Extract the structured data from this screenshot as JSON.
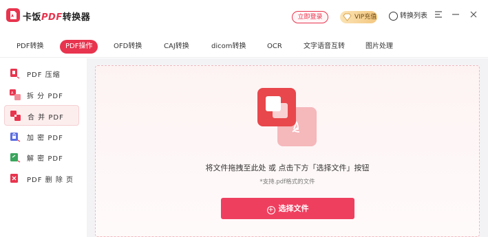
{
  "app": {
    "title_prefix": "卡饭",
    "title_pdf": "PDF",
    "title_suffix": "转换器"
  },
  "header": {
    "login_label": "立即登录",
    "vip_label": "VIP充值",
    "convert_list_label": "转换列表"
  },
  "nav": {
    "tabs": [
      {
        "label": "PDF转换"
      },
      {
        "label": "PDF操作"
      },
      {
        "label": "OFD转换"
      },
      {
        "label": "CAJ转换"
      },
      {
        "label": "dicom转换"
      },
      {
        "label": "OCR"
      },
      {
        "label": "文字语音互转"
      },
      {
        "label": "图片处理"
      }
    ],
    "active_index": 1
  },
  "sidebar": {
    "items": [
      {
        "label": "PDF 压缩",
        "icon": "compress-icon"
      },
      {
        "label": "拆 分 PDF",
        "icon": "split-icon"
      },
      {
        "label": "合 并 PDF",
        "icon": "merge-icon"
      },
      {
        "label": "加 密 PDF",
        "icon": "lock-icon"
      },
      {
        "label": "解 密 PDF",
        "icon": "unlock-icon"
      },
      {
        "label": "PDF 删 除 页",
        "icon": "delete-page-icon"
      }
    ],
    "active_index": 2
  },
  "main": {
    "hint": "将文件拖拽至此处 或 点击下方「选择文件」按钮",
    "sub_hint": "*支持.pdf格式的文件",
    "select_button_label": "选择文件"
  },
  "colors": {
    "accent": "#e8344e",
    "button": "#ef3f5f",
    "vip_gold": "#f3c77f"
  }
}
